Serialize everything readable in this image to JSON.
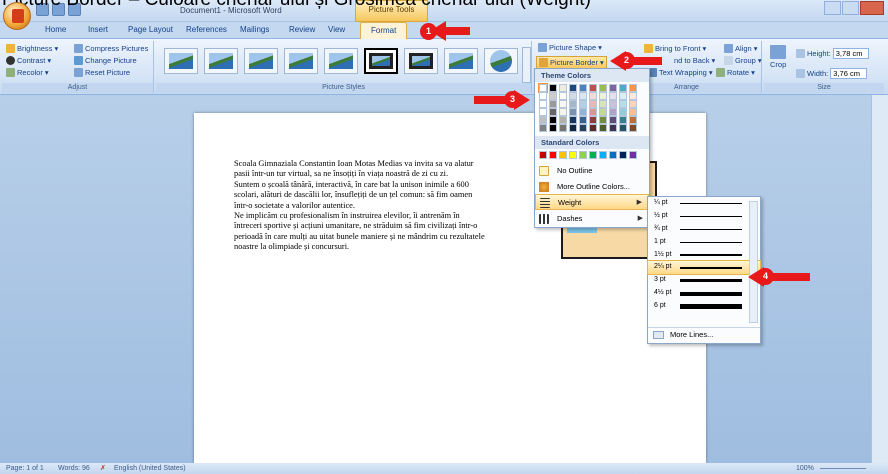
{
  "caption": "Picture Border – Culoare chenar ului și Grosimea chenar ului (Weight)",
  "window": {
    "title": "Document1 - Microsoft Word",
    "context_tab": "Picture Tools"
  },
  "tabs": [
    "Home",
    "Insert",
    "Page Layout",
    "References",
    "Mailings",
    "Review",
    "View",
    "Format"
  ],
  "active_tab": "Format",
  "ribbon": {
    "adjust": {
      "label": "Adjust",
      "items": [
        "Brightness",
        "Compress Pictures",
        "Contrast",
        "Change Picture",
        "Recolor",
        "Reset Picture"
      ]
    },
    "picture_styles": {
      "label": "Picture Styles"
    },
    "picture_shape": "Picture Shape",
    "picture_border": "Picture Border",
    "arrange": {
      "label": "Arrange",
      "items": [
        "Bring to Front",
        "Align",
        "nd to Back",
        "Group",
        "Text Wrapping",
        "Rotate"
      ]
    },
    "size": {
      "label": "Size",
      "crop": "Crop",
      "height_label": "Height:",
      "height_value": "3,78 cm",
      "width_label": "Width:",
      "width_value": "3,76 cm"
    }
  },
  "document": {
    "paragraphs": [
      "Scoala Gimnaziala Constantin Ioan Motas Medias va invita sa va alatur",
      "pasii într-un tur virtual, sa ne însoțiți în viața noastră de zi cu zi.",
      "Suntem o școală tânără, interactivă, în care bat la unison inimile a 600",
      "scolari, alături de dascălii lor, însuflețiți de un țel comun: să fim oamen",
      "într-o societate a valorilor autentice.",
      "Ne implicăm cu profesionalism în instruirea elevilor, îi antrenăm în",
      "întreceri sportive și acțiuni umanitare, ne străduim să fim civilizați într-o",
      "perioadă în care mulți au uitat bunele maniere și ne mândrim cu rezultatele",
      "noastre la olimpiade și concursuri."
    ]
  },
  "border_menu": {
    "theme_colors_label": "Theme Colors",
    "standard_colors_label": "Standard Colors",
    "items": [
      "No Outline",
      "More Outline Colors...",
      "Weight",
      "Dashes"
    ],
    "theme_colors": [
      "#ffffff",
      "#000000",
      "#eeece1",
      "#1f497d",
      "#4f81bd",
      "#c0504d",
      "#9bbb59",
      "#8064a2",
      "#4bacc6",
      "#f79646"
    ],
    "standard_colors": [
      "#c00000",
      "#ff0000",
      "#ffc000",
      "#ffff00",
      "#92d050",
      "#00b050",
      "#00b0f0",
      "#0070c0",
      "#002060",
      "#7030a0"
    ]
  },
  "weight_menu": {
    "options": [
      "¼ pt",
      "½ pt",
      "¾ pt",
      "1 pt",
      "1½ pt",
      "2¼ pt",
      "3 pt",
      "4½ pt",
      "6 pt"
    ],
    "selected": "2¼ pt",
    "more": "More Lines..."
  },
  "callouts": [
    "1",
    "2",
    "3",
    "4"
  ],
  "status": {
    "page": "Page: 1 of 1",
    "words": "Words: 96",
    "language": "English (United States)",
    "zoom": "100%"
  }
}
